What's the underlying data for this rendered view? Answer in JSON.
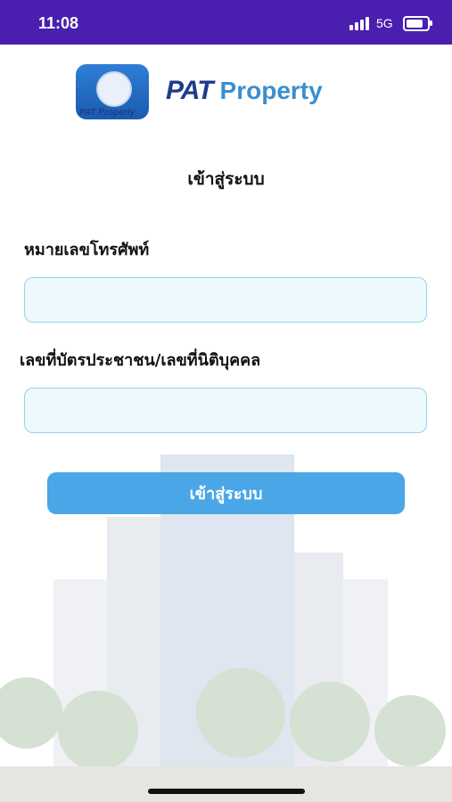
{
  "status_bar": {
    "time": "11:08",
    "network": "5G"
  },
  "logo": {
    "app_icon_caption": "PAT Property",
    "brand_mark": "PAT",
    "brand_word": "Property"
  },
  "login": {
    "title": "เข้าสู่ระบบ",
    "phone_label": "หมายเลขโทรศัพท์",
    "phone_value": "",
    "id_label": "เลขที่บัตรประชาชน/เลขที่นิติบุคคล",
    "id_value": "",
    "submit_label": "เข้าสู่ระบบ"
  },
  "colors": {
    "status_bar": "#4a1fb0",
    "button": "#4aa6e6",
    "field_border": "#8fd5ea",
    "brand_dark": "#1f3c8a",
    "brand_light": "#3a8fd0"
  }
}
